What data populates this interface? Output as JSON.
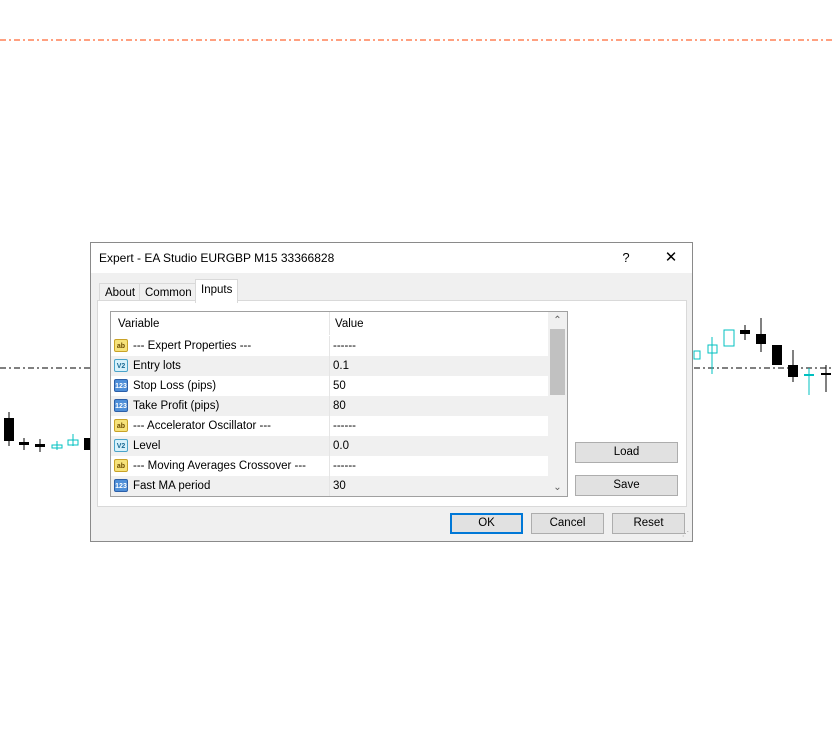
{
  "dialog": {
    "title": "Expert - EA Studio EURGBP M15 33366828",
    "help_label": "?",
    "close_label": "✕",
    "tabs": [
      {
        "label": "About",
        "active": false
      },
      {
        "label": "Common",
        "active": false
      },
      {
        "label": "Inputs",
        "active": true
      }
    ],
    "grid": {
      "columns": [
        "Variable",
        "Value"
      ],
      "rows": [
        {
          "icon": "ab",
          "icon_name": "string-type-icon",
          "variable": "--- Expert Properties ---",
          "value": "------"
        },
        {
          "icon": "V2",
          "icon_name": "double-type-icon",
          "variable": "Entry lots",
          "value": "0.1"
        },
        {
          "icon": "123",
          "icon_name": "integer-type-icon",
          "variable": "Stop Loss   (pips)",
          "value": "50"
        },
        {
          "icon": "123",
          "icon_name": "integer-type-icon",
          "variable": "Take Profit (pips)",
          "value": "80"
        },
        {
          "icon": "ab",
          "icon_name": "string-type-icon",
          "variable": "--- Accelerator Oscillator ---",
          "value": "------"
        },
        {
          "icon": "V2",
          "icon_name": "double-type-icon",
          "variable": "Level",
          "value": "0.0"
        },
        {
          "icon": "ab",
          "icon_name": "string-type-icon",
          "variable": "--- Moving Averages Crossover ---",
          "value": "------"
        },
        {
          "icon": "123",
          "icon_name": "integer-type-icon",
          "variable": "Fast MA period",
          "value": "30"
        }
      ],
      "scroll_up": "⌃",
      "scroll_down": "⌄"
    },
    "buttons": {
      "load": "Load",
      "save": "Save",
      "ok": "OK",
      "cancel": "Cancel",
      "reset": "Reset"
    },
    "resize_grip": "⋰"
  },
  "chart": {
    "bull_color": "#00c0c0",
    "bear_color": "#000000",
    "line_color": "#ff4000",
    "level_color": "#000000"
  }
}
